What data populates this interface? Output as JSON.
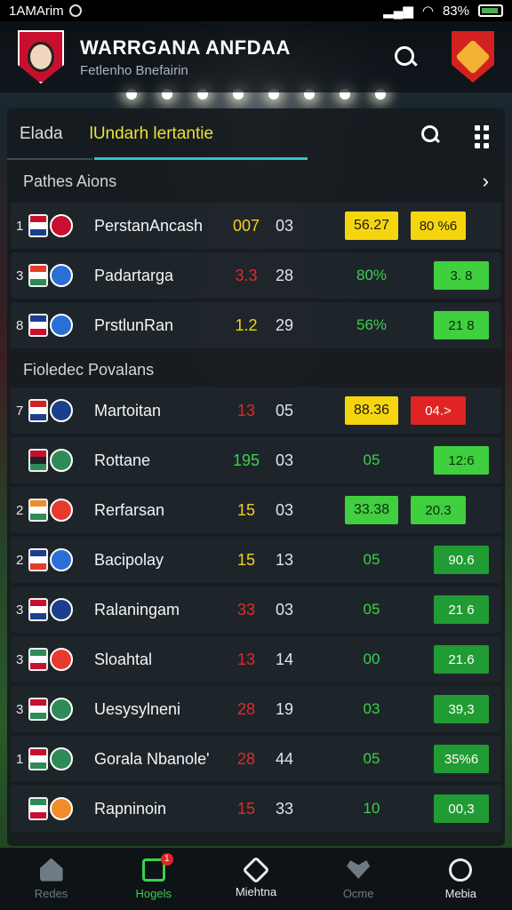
{
  "status_bar": {
    "time": "1AMArim",
    "battery": "83%"
  },
  "header": {
    "title": "WARRGANA ANFDAA",
    "subtitle": "Fetlenho Bnefairin"
  },
  "tabs": [
    {
      "label": "Elada"
    },
    {
      "label": "lUndarh lertantie"
    }
  ],
  "sections": {
    "first": {
      "title": "Pathes Aions"
    },
    "second": {
      "title": "Fioledec Povalans"
    }
  },
  "rows": [
    {
      "rank": "1",
      "name": "PerstanAncash",
      "v1": "007",
      "v1_color": "y",
      "v2": "03",
      "v3": "",
      "odds": "56.27",
      "odds_style": "fill-yellow",
      "chip": "80 %6",
      "chip_style": "fill-yellow"
    },
    {
      "rank": "3",
      "name": "Padartarga",
      "v1": "3.3",
      "v1_color": "r",
      "v2": "28",
      "v3": "80%",
      "odds": "",
      "odds_style": "",
      "chip": "3. 8",
      "chip_style": "fill-green"
    },
    {
      "rank": "8",
      "name": "PrstlunRan",
      "v1": "1.2",
      "v1_color": "y",
      "v2": "29",
      "v3": "56%",
      "odds": "",
      "odds_style": "",
      "chip": "21 8",
      "chip_style": "fill-green"
    },
    {
      "rank": "7",
      "name": "Martoitan",
      "v1": "13",
      "v1_color": "r",
      "v2": "05",
      "v3": "",
      "odds": "88.36",
      "odds_style": "fill-yellow",
      "chip": "04.>",
      "chip_style": "fill-red"
    },
    {
      "rank": "",
      "name": "Rottane",
      "v1": "195",
      "v1_color": "g",
      "v2": "03",
      "v3": "05",
      "odds": "",
      "odds_style": "",
      "chip": "12:6",
      "chip_style": "fill-green"
    },
    {
      "rank": "2",
      "name": "Rerfarsan",
      "v1": "15",
      "v1_color": "y",
      "v2": "03",
      "v3": "",
      "odds": "33.38",
      "odds_style": "fill-green",
      "chip": "20.3",
      "chip_style": "fill-green"
    },
    {
      "rank": "2",
      "name": "Bacipolay",
      "v1": "15",
      "v1_color": "y",
      "v2": "13",
      "v3": "05",
      "odds": "",
      "odds_style": "",
      "chip": "90.6",
      "chip_style": "fill-dkgreen"
    },
    {
      "rank": "3",
      "name": "Ralaningam",
      "v1": "33",
      "v1_color": "r",
      "v2": "03",
      "v3": "05",
      "odds": "",
      "odds_style": "",
      "chip": "21 6",
      "chip_style": "fill-dkgreen"
    },
    {
      "rank": "3",
      "name": "Sloahtal",
      "v1": "13",
      "v1_color": "r",
      "v2": "14",
      "v3": "00",
      "odds": "",
      "odds_style": "",
      "chip": "21.6",
      "chip_style": "fill-dkgreen"
    },
    {
      "rank": "3",
      "name": "Uesysylneni",
      "v1": "28",
      "v1_color": "r",
      "v2": "19",
      "v3": "03",
      "odds": "",
      "odds_style": "",
      "chip": "39,3",
      "chip_style": "fill-dkgreen"
    },
    {
      "rank": "1",
      "name": "Gorala Nbanole'",
      "v1": "28",
      "v1_color": "r",
      "v2": "44",
      "v3": "05",
      "odds": "",
      "odds_style": "",
      "chip": "35%6",
      "chip_style": "fill-dkgreen"
    },
    {
      "rank": "",
      "name": "Rapninoin",
      "v1": "15",
      "v1_color": "r",
      "v2": "33",
      "v3": "10",
      "odds": "",
      "odds_style": "",
      "chip": "00,3",
      "chip_style": "fill-dkgreen"
    }
  ],
  "nav": [
    {
      "label": "Redes",
      "icon": "home-icon"
    },
    {
      "label": "Hogels",
      "icon": "calendar-icon",
      "badge": "1"
    },
    {
      "label": "Miehtna",
      "icon": "diamond-icon"
    },
    {
      "label": "Ocme",
      "icon": "heart-icon"
    },
    {
      "label": "Mebia",
      "icon": "person-icon"
    }
  ]
}
